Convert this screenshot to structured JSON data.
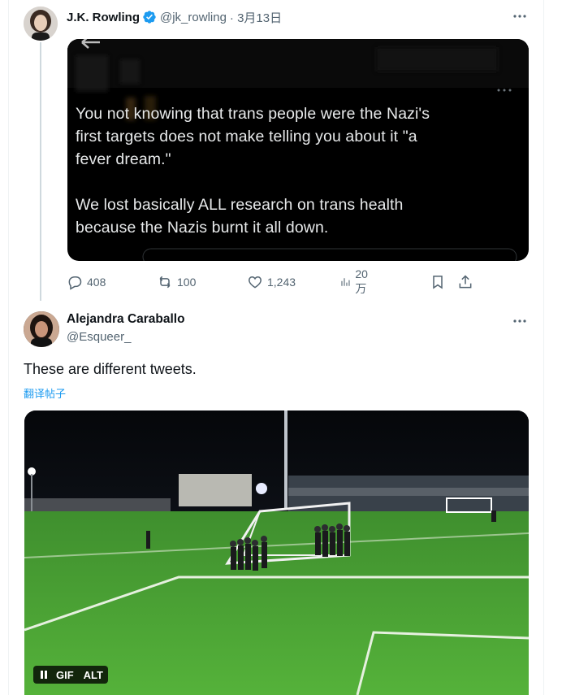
{
  "tweet1": {
    "author_name": "J.K. Rowling",
    "handle": "@jk_rowling",
    "date": "· 3月13日",
    "quote_image_text": {
      "paragraph1": "You not knowing that trans people were the Nazi's first targets does not make telling you about it \"a fever dream.\"",
      "paragraph2": "We lost basically ALL research on trans health because the Nazis burnt it all down."
    },
    "actions": {
      "replies": "408",
      "retweets": "100",
      "likes": "1,243",
      "views": "20万"
    }
  },
  "tweet2": {
    "author_name": "Alejandra Caraballo",
    "handle": "@Esqueer_",
    "text": "These are different tweets.",
    "translate_link": "翻译帖子",
    "media_badges": {
      "gif": "GIF",
      "alt": "ALT"
    }
  },
  "colors": {
    "accent": "#1d9bf0",
    "muted": "#536471",
    "text": "#0f1419"
  }
}
